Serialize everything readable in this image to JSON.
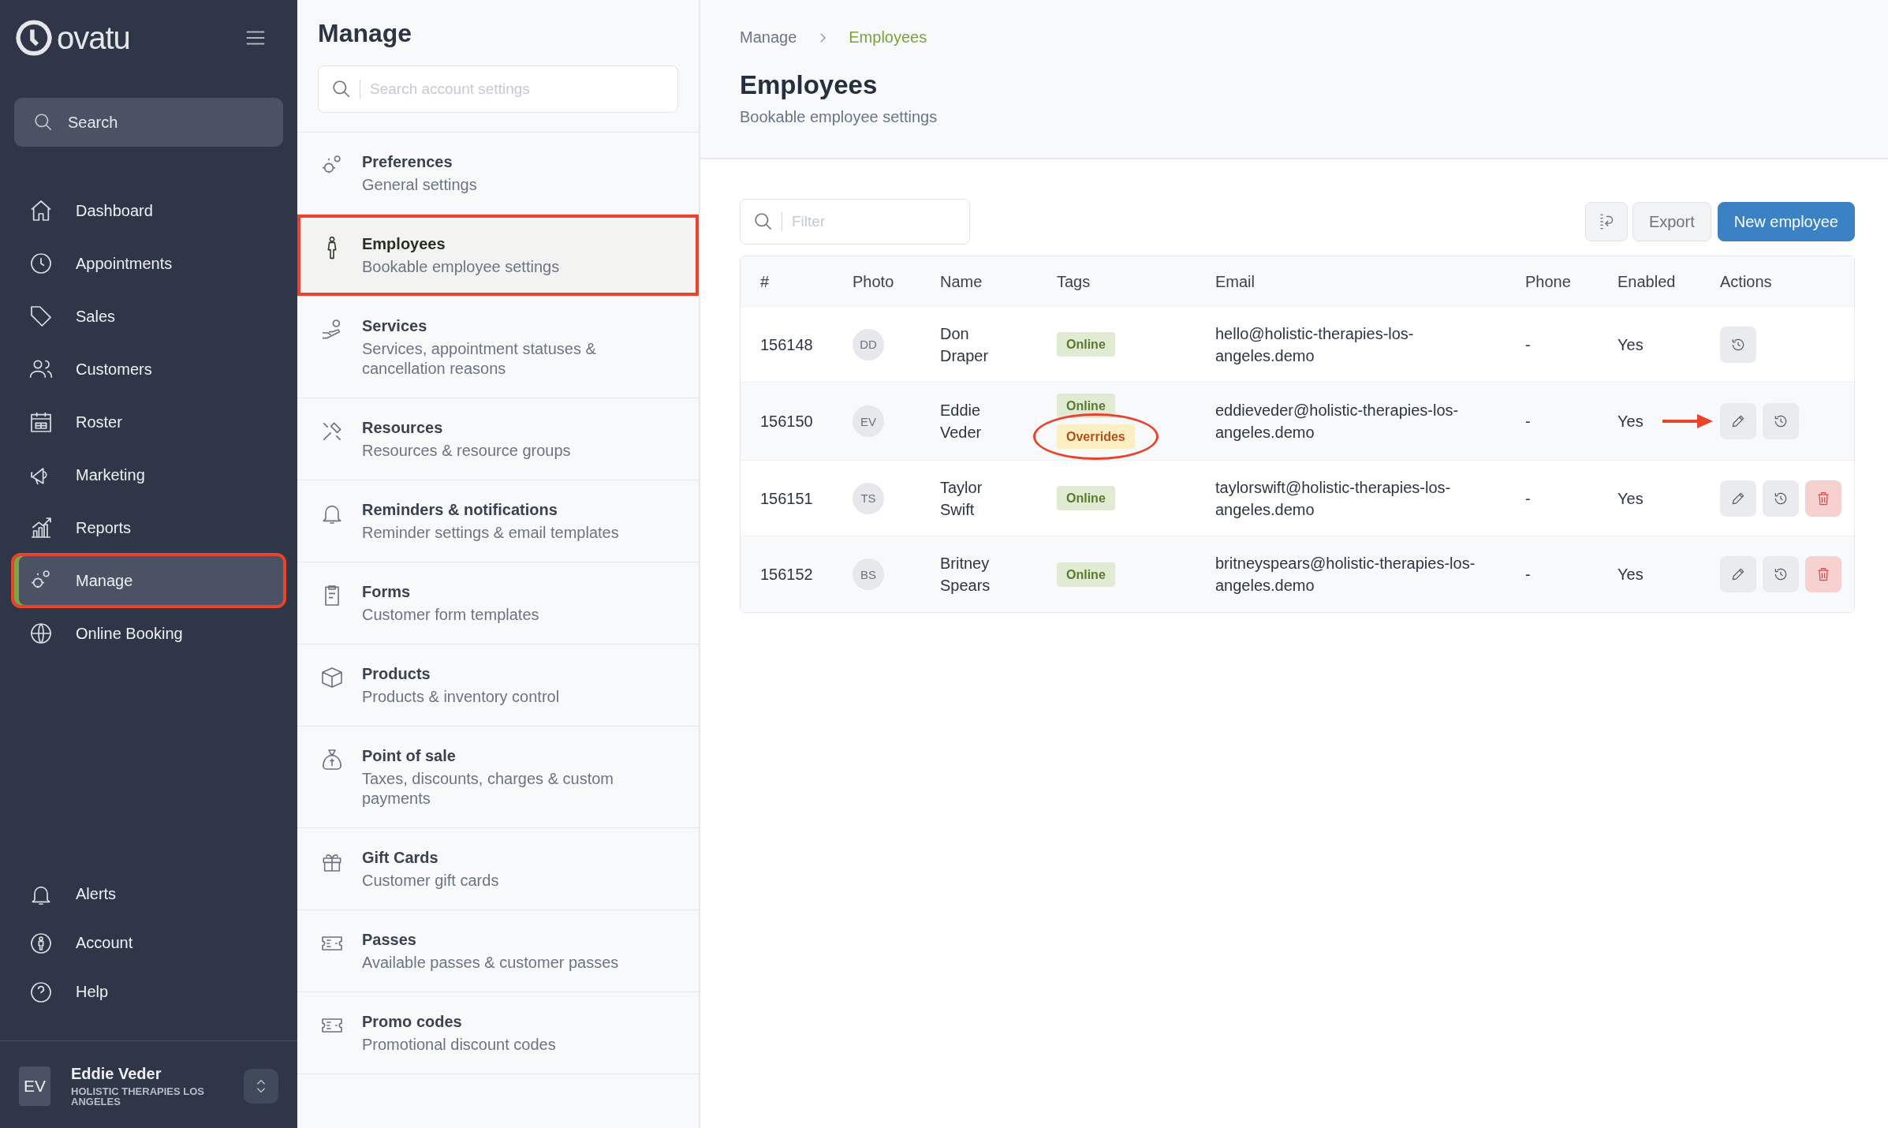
{
  "logo": {
    "text": "ovatu"
  },
  "sidebar": {
    "search": {
      "placeholder": "Search"
    },
    "nav": [
      {
        "label": "Dashboard",
        "selected": false,
        "highlighted": false
      },
      {
        "label": "Appointments",
        "selected": false,
        "highlighted": false
      },
      {
        "label": "Sales",
        "selected": false,
        "highlighted": false
      },
      {
        "label": "Customers",
        "selected": false,
        "highlighted": false
      },
      {
        "label": "Roster",
        "selected": false,
        "highlighted": false
      },
      {
        "label": "Marketing",
        "selected": false,
        "highlighted": false
      },
      {
        "label": "Reports",
        "selected": false,
        "highlighted": false
      },
      {
        "label": "Manage",
        "selected": true,
        "highlighted": true
      },
      {
        "label": "Online Booking",
        "selected": false,
        "highlighted": false
      }
    ],
    "bottom_nav": [
      {
        "label": "Alerts"
      },
      {
        "label": "Account"
      },
      {
        "label": "Help"
      }
    ],
    "user": {
      "initials": "EV",
      "name": "Eddie Veder",
      "organization": "HOLISTIC THERAPIES LOS ANGELES"
    }
  },
  "settings_panel": {
    "title": "Manage",
    "search": {
      "placeholder": "Search account settings"
    },
    "items": [
      {
        "title": "Preferences",
        "description": "General settings",
        "selected": false,
        "highlighted": false
      },
      {
        "title": "Employees",
        "description": "Bookable employee settings",
        "selected": true,
        "highlighted": true
      },
      {
        "title": "Services",
        "description": "Services, appointment statuses & cancellation reasons",
        "selected": false,
        "highlighted": false
      },
      {
        "title": "Resources",
        "description": "Resources & resource groups",
        "selected": false,
        "highlighted": false
      },
      {
        "title": "Reminders & notifications",
        "description": "Reminder settings & email templates",
        "selected": false,
        "highlighted": false
      },
      {
        "title": "Forms",
        "description": "Customer form templates",
        "selected": false,
        "highlighted": false
      },
      {
        "title": "Products",
        "description": "Products & inventory control",
        "selected": false,
        "highlighted": false
      },
      {
        "title": "Point of sale",
        "description": "Taxes, discounts, charges & custom payments",
        "selected": false,
        "highlighted": false
      },
      {
        "title": "Gift Cards",
        "description": "Customer gift cards",
        "selected": false,
        "highlighted": false
      },
      {
        "title": "Passes",
        "description": "Available passes & customer passes",
        "selected": false,
        "highlighted": false
      },
      {
        "title": "Promo codes",
        "description": "Promotional discount codes",
        "selected": false,
        "highlighted": false
      }
    ]
  },
  "breadcrumb": [
    "Manage",
    "Employees"
  ],
  "page": {
    "title": "Employees",
    "subtitle": "Bookable employee settings"
  },
  "toolbar": {
    "filter": {
      "placeholder": "Filter"
    },
    "export": "Export",
    "new_button": "New employee"
  },
  "table": {
    "columns": [
      "#",
      "Photo",
      "Name",
      "Tags",
      "Email",
      "Phone",
      "Enabled",
      "Actions"
    ],
    "rows": [
      {
        "id": "156148",
        "initials": "DD",
        "name": "Don Draper",
        "tags": [
          {
            "label": "Online",
            "kind": "online",
            "circled": false
          }
        ],
        "email": "hello@holistic-therapies-los-angeles.demo",
        "phone": "-",
        "enabled": "Yes",
        "actions": [
          {
            "kind": "history"
          }
        ],
        "arrow": false
      },
      {
        "id": "156150",
        "initials": "EV",
        "name": "Eddie Veder",
        "tags": [
          {
            "label": "Online",
            "kind": "online",
            "circled": false
          },
          {
            "label": "Overrides",
            "kind": "overrides",
            "circled": true
          }
        ],
        "email": "eddieveder@holistic-therapies-los-angeles.demo",
        "phone": "-",
        "enabled": "Yes",
        "actions": [
          {
            "kind": "edit"
          },
          {
            "kind": "history"
          }
        ],
        "arrow": true
      },
      {
        "id": "156151",
        "initials": "TS",
        "name": "Taylor Swift",
        "tags": [
          {
            "label": "Online",
            "kind": "online",
            "circled": false
          }
        ],
        "email": "taylorswift@holistic-therapies-los-angeles.demo",
        "phone": "-",
        "enabled": "Yes",
        "actions": [
          {
            "kind": "edit"
          },
          {
            "kind": "history"
          },
          {
            "kind": "delete"
          }
        ],
        "arrow": false
      },
      {
        "id": "156152",
        "initials": "BS",
        "name": "Britney Spears",
        "tags": [
          {
            "label": "Online",
            "kind": "online",
            "circled": false
          }
        ],
        "email": "britneyspears@holistic-therapies-los-angeles.demo",
        "phone": "-",
        "enabled": "Yes",
        "actions": [
          {
            "kind": "edit"
          },
          {
            "kind": "history"
          },
          {
            "kind": "delete"
          }
        ],
        "arrow": false
      }
    ]
  }
}
